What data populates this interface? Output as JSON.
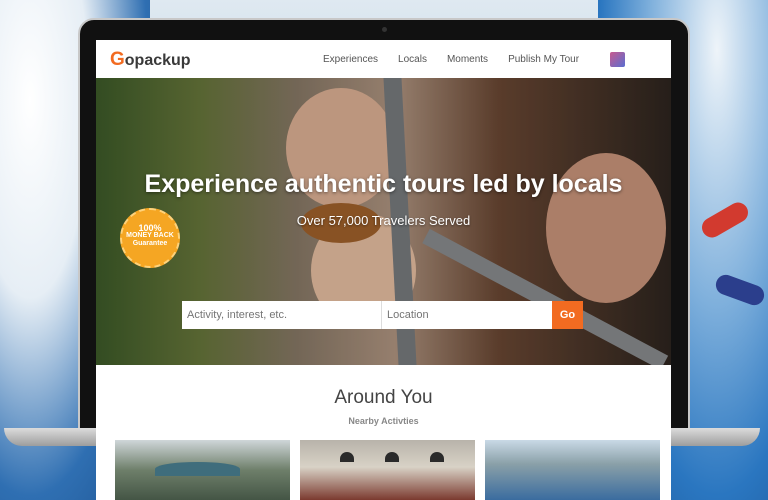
{
  "app": {
    "logo_text": "Gopackup",
    "logo_mark": "G",
    "logo_rest": "opackup",
    "brand_color": "#f26b21"
  },
  "nav": {
    "items": [
      {
        "label": "Experiences"
      },
      {
        "label": "Locals"
      },
      {
        "label": "Moments"
      },
      {
        "label": "Publish My Tour"
      }
    ]
  },
  "hero": {
    "headline": "Experience authentic tours led by locals",
    "subline": "Over 57,000 Travelers Served",
    "badge": {
      "line1": "100%",
      "line2": "MONEY BACK",
      "line3": "Guarantee"
    }
  },
  "search": {
    "activity_placeholder": "Activity, interest, etc.",
    "location_placeholder": "Location",
    "go_label": "Go"
  },
  "section": {
    "title": "Around You",
    "subtitle": "Nearby Activties"
  }
}
